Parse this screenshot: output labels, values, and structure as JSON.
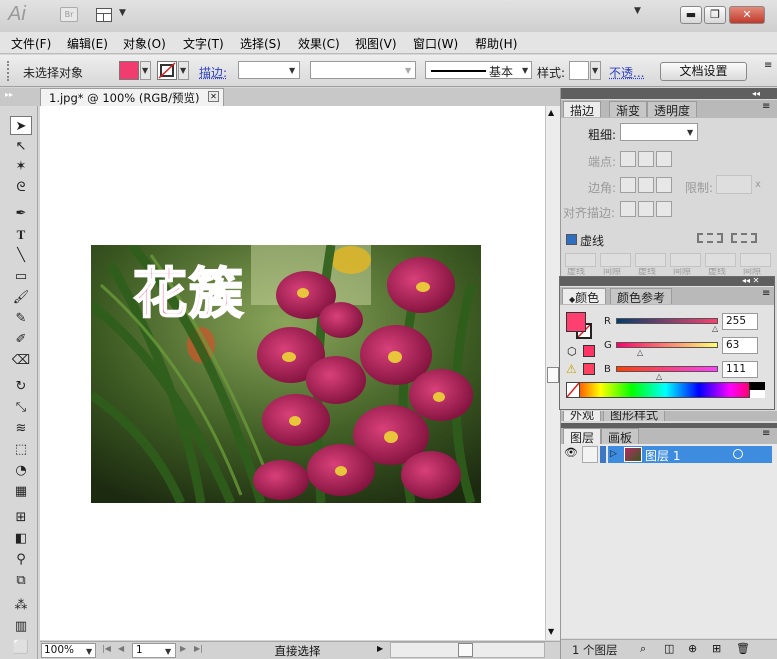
{
  "app": {
    "logo": "Ai",
    "bridge": "Br"
  },
  "menu": [
    "文件(F)",
    "编辑(E)",
    "对象(O)",
    "文字(T)",
    "选择(S)",
    "效果(C)",
    "视图(V)",
    "窗口(W)",
    "帮助(H)"
  ],
  "control": {
    "selection_status": "未选择对象",
    "stroke_link": "描边:",
    "stroke_style": "基本",
    "style_label": "样式:",
    "opacity_link": "不透...",
    "doc_settings": "文档设置",
    "fill_color": "#f03c6f"
  },
  "document": {
    "tab_title": "1.jpg* @ 100% (RGB/预览)"
  },
  "artwork": {
    "text": "花簇",
    "text_color": "#f2567f"
  },
  "status": {
    "zoom": "100%",
    "page": "1",
    "tool": "直接选择"
  },
  "stroke_panel": {
    "tabs": [
      "描边",
      "渐变",
      "透明度"
    ],
    "weight_label": "粗细:",
    "cap_label": "端点:",
    "corner_label": "边角:",
    "limit_label": "限制:",
    "limit_unit": "x",
    "align_label": "对齐描边:",
    "dashed_label": "虚线",
    "dash_labels": [
      "虚线",
      "间隙",
      "虚线",
      "间隙",
      "虚线",
      "间隙"
    ]
  },
  "color_panel": {
    "tabs": [
      "颜色",
      "颜色参考"
    ],
    "channels": [
      {
        "name": "R",
        "value": "255"
      },
      {
        "name": "G",
        "value": "63"
      },
      {
        "name": "B",
        "value": "111"
      }
    ],
    "swatch": "#ff3f6f"
  },
  "appearance_tabs": [
    "外观",
    "图形样式"
  ],
  "layers_panel": {
    "tabs": [
      "图层",
      "画板"
    ],
    "layer_name": "图层 1",
    "footer_count": "1 个图层"
  }
}
